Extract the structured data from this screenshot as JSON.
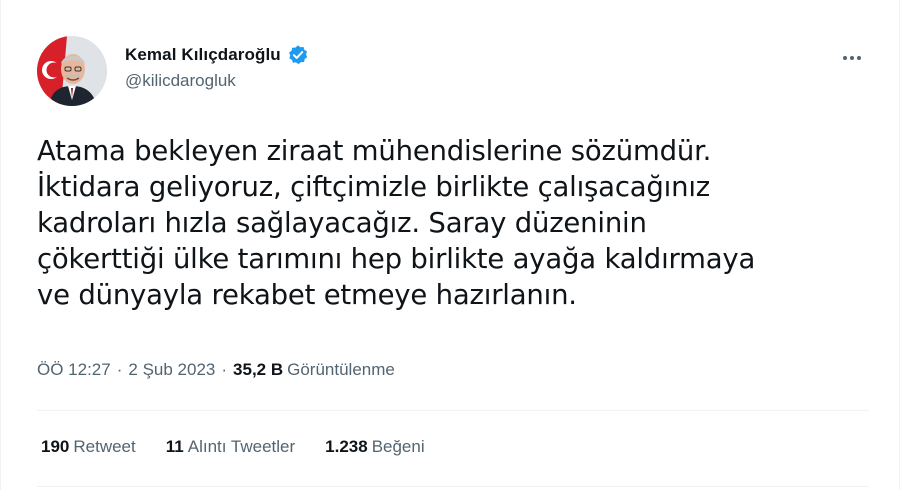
{
  "author": {
    "display_name": "Kemal Kılıçdaroğlu",
    "handle": "@kilicdarogluk",
    "verified_icon": "verified-badge-icon",
    "verified_color": "#1d9bf0"
  },
  "tweet": {
    "lines": [
      "Atama bekleyen ziraat mühendislerine sözümdür.",
      "İktidara geliyoruz, çiftçimizle birlikte çalışacağınız",
      "kadroları hızla sağlayacağız. Saray düzeninin",
      "çökerttiği ülke tarımını hep birlikte ayağa kaldırmaya",
      "ve dünyayla rekabet etmeye hazırlanın."
    ]
  },
  "meta": {
    "time": "ÖÖ 12:27",
    "separator": "·",
    "date": "2 Şub 2023",
    "views_count": "35,2 B",
    "views_label": "Görüntülenme"
  },
  "stats": {
    "retweets_count": "190",
    "retweets_label": "Retweet",
    "quotes_count": "11",
    "quotes_label": "Alıntı Tweetler",
    "likes_count": "1.238",
    "likes_label": "Beğeni"
  },
  "colors": {
    "text_primary": "#0f1419",
    "text_secondary": "#536471",
    "divider": "#eff3f4",
    "accent": "#1d9bf0"
  },
  "icons": {
    "more": "more-horizontal-icon"
  }
}
